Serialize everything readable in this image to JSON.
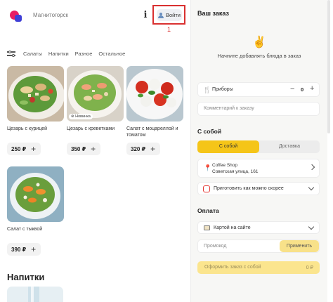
{
  "header": {
    "city": "Магнитогорск",
    "info_label": "i",
    "login_label": "Войти",
    "marker": "1"
  },
  "categories": [
    "Салаты",
    "Напитки",
    "Разное",
    "Остальное"
  ],
  "products": [
    {
      "name": "Цезарь с курицей",
      "price": "250 ₽",
      "badge": ""
    },
    {
      "name": "Цезарь с креветками",
      "price": "350 ₽",
      "badge": "Новинка"
    },
    {
      "name": "Салат с моцареллой и томатом",
      "price": "320 ₽",
      "badge": ""
    },
    {
      "name": "Салат с тыквой",
      "price": "390 ₽",
      "badge": ""
    }
  ],
  "plus_label": "+",
  "drinks_section": "Напитки",
  "cart": {
    "title": "Ваш заказ",
    "empty": "Начните добавлять блюда в заказ",
    "devices_label": "Приборы",
    "devices_count": "0",
    "minus": "−",
    "plus": "+",
    "comment_placeholder": "Комментарий к заказу",
    "takeaway_title": "С собой",
    "toggle_active": "С собой",
    "toggle_inactive": "Доставка",
    "shop_name": "Coffee Shop",
    "shop_address": "Советская улица, 161",
    "time_label": "Приготовить как можно скорее",
    "payment_title": "Оплата",
    "payment_method": "Картой на сайте",
    "promo_placeholder": "Промокод",
    "apply_label": "Применить",
    "order_label": "Оформить заказ с собой",
    "order_total": "0 ₽"
  },
  "colors": {
    "accent": "#f5c518",
    "login_highlight": "#d93030",
    "disabled_button": "#fbe58e"
  }
}
